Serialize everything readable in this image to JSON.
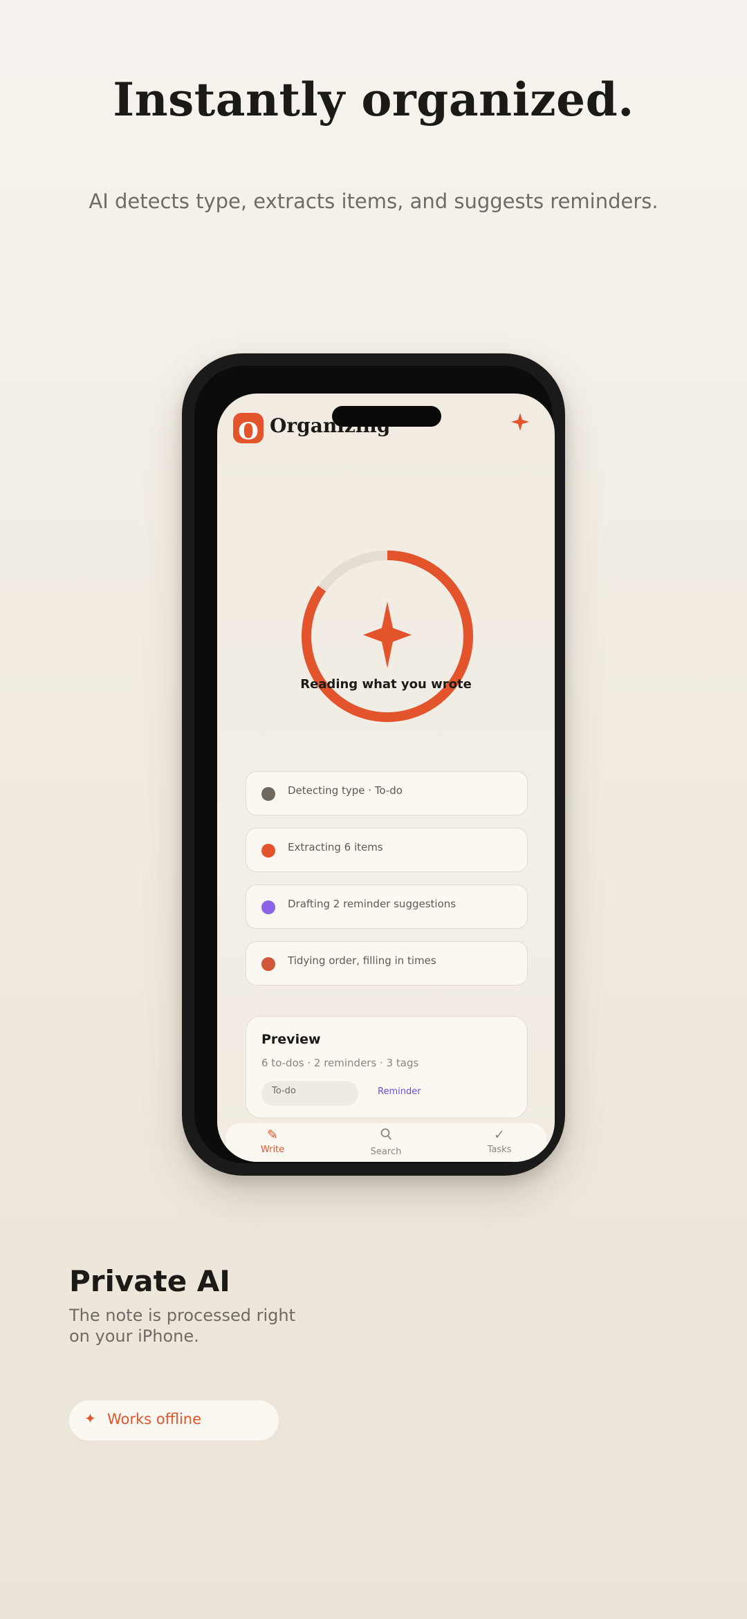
{
  "headline": "Instantly organized.",
  "subhead": "AI detects type, extracts items, and suggests reminders.",
  "app": {
    "logo_letter": "O",
    "title": "Organizing",
    "top_icon": "sparkle-icon",
    "progress_fraction": 0.85,
    "status_text": "Reading what you wrote",
    "accent_color": "#e4542c"
  },
  "steps": [
    {
      "label": "Detecting type · To-do",
      "color": "#6e685e"
    },
    {
      "label": "Extracting 6 items",
      "color": "#e4542c"
    },
    {
      "label": "Drafting 2 reminder suggestions",
      "color": "#8a63e6"
    },
    {
      "label": "Tidying order, filling in times",
      "color": "#d0573a"
    }
  ],
  "preview": {
    "title": "Preview",
    "meta": "6 to-dos · 2 reminders · 3 tags",
    "chip_todo": "To-do",
    "chip_reminder": "Reminder"
  },
  "tabs": [
    {
      "label": "Write",
      "icon": "pencil-icon",
      "active": true
    },
    {
      "label": "Search",
      "icon": "search-icon",
      "active": false
    },
    {
      "label": "Tasks",
      "icon": "check-icon",
      "active": false
    }
  ],
  "private": {
    "title": "Private AI",
    "desc": "The note is processed right on your iPhone.",
    "pill_label": "Works offline"
  }
}
